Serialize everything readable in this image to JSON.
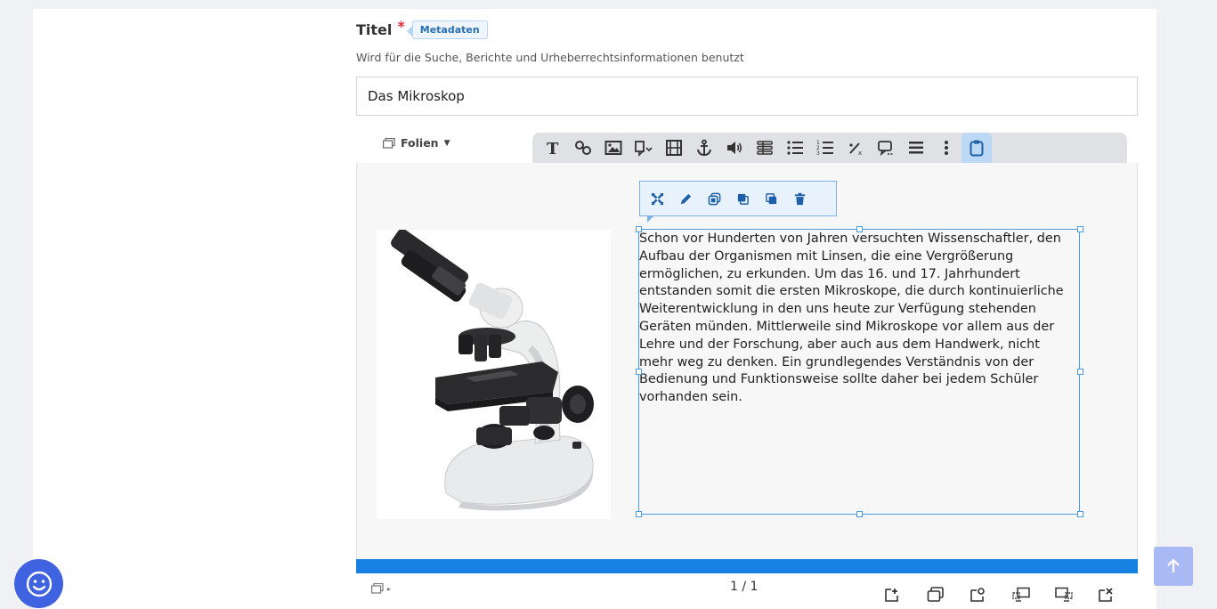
{
  "title_field": {
    "label": "Titel",
    "required_mark": "*",
    "badge": "Metadaten",
    "help_text": "Wird für die Suche, Berichte und Urheberrechtsinformationen benutzt",
    "value": "Das Mikroskop"
  },
  "editor": {
    "slides_menu_label": "Folien",
    "toolbar_icons": [
      "text-icon",
      "link-icon",
      "image-icon",
      "shape-icon",
      "video-icon",
      "anchor-icon",
      "audio-icon",
      "table-icon",
      "list-icon",
      "ordered-list-icon",
      "fraction-icon",
      "speech-bubble-icon",
      "bulleted-list-icon",
      "more-icon",
      "clipboard-icon"
    ],
    "context_icons": [
      "fit-icon",
      "edit-icon",
      "copy-icon",
      "bring-front-icon",
      "send-back-icon",
      "delete-icon"
    ],
    "slide_text": "Schon vor Hunderten von Jahren versuchten Wissenschaftler, den\nAufbau der Organismen mit Linsen, die eine Vergrößerung\nermöglichen, zu erkunden. Um das 16. und 17. Jahrhundert\nentstanden somit die ersten Mikroskope, die durch kontinuierliche\nWeiterentwicklung in den uns heute zur Verfügung stehenden\nGeräten münden. Mittlerweile sind Mikroskope vor allem aus der\nLehre und der Forschung, aber auch aus dem Handwerk, nicht\nmehr weg zu denken. Ein grundlegendes Verständnis von der\nBedienung und Funktionsweise sollte daher bei jedem Schüler\nvorhanden sein.",
    "slide_counter": "1 / 1",
    "progress_fraction": 1.0,
    "footer_icons": [
      "add-slide-icon",
      "clone-slide-icon",
      "slide-settings-icon",
      "move-slide-left-icon",
      "move-slide-right-icon",
      "delete-slide-icon"
    ]
  },
  "colors": {
    "accent": "#1681e0",
    "selection": "#4b9be0",
    "chat": "#3f63e0",
    "required": "#e3283b"
  }
}
